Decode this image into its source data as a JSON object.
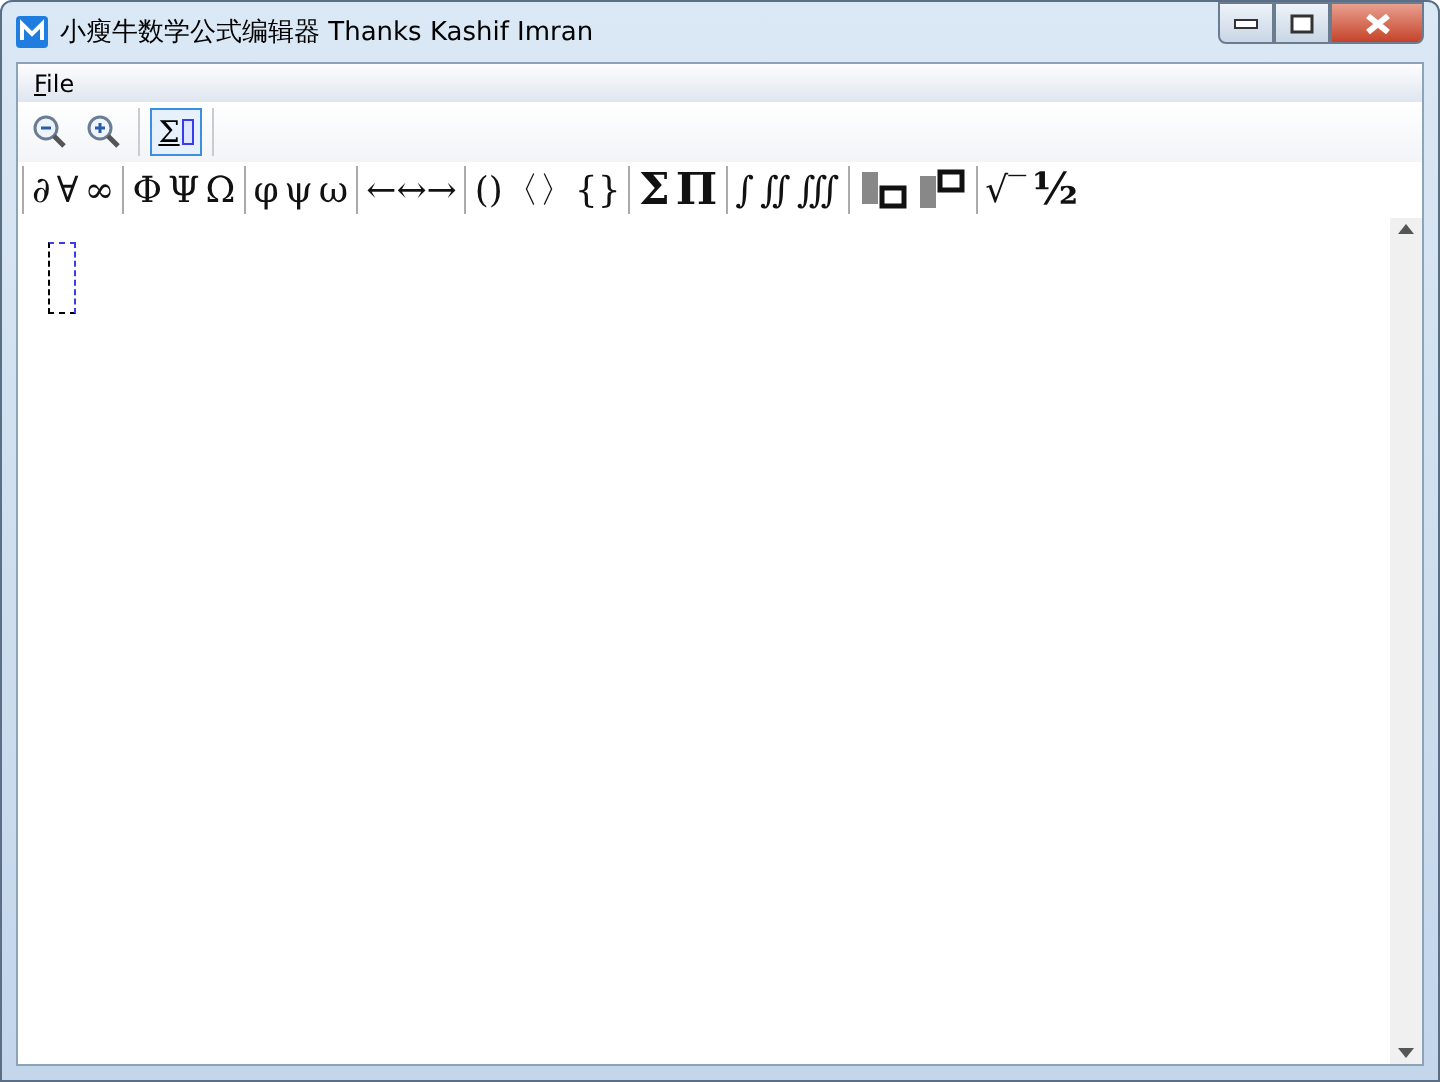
{
  "window": {
    "title": "小瘦牛数学公式编辑器 Thanks Kashif Imran"
  },
  "menu": [
    {
      "access_key": "F",
      "label_rest": "ile"
    }
  ],
  "toolbar": [
    {
      "kind": "zoom-out",
      "selected": false
    },
    {
      "kind": "zoom-in",
      "selected": false
    },
    {
      "kind": "sigma-toggle",
      "label": "Σ",
      "selected": true
    }
  ],
  "symbol_groups": [
    {
      "items": [
        {
          "kind": "text",
          "label": "∂"
        },
        {
          "kind": "text",
          "label": "∀"
        },
        {
          "kind": "text",
          "label": "∞"
        }
      ]
    },
    {
      "items": [
        {
          "kind": "text",
          "label": "Φ"
        },
        {
          "kind": "text",
          "label": "Ψ"
        },
        {
          "kind": "text",
          "label": "Ω"
        }
      ]
    },
    {
      "items": [
        {
          "kind": "text",
          "label": "φ"
        },
        {
          "kind": "text",
          "label": "ψ"
        },
        {
          "kind": "text",
          "label": "ω"
        }
      ]
    },
    {
      "items": [
        {
          "kind": "text",
          "label": "←↔→"
        }
      ]
    },
    {
      "items": [
        {
          "kind": "text",
          "label": "()〈〉{}"
        }
      ]
    },
    {
      "items": [
        {
          "kind": "big",
          "label": "Σ"
        },
        {
          "kind": "big",
          "label": "Π"
        }
      ]
    },
    {
      "items": [
        {
          "kind": "text",
          "label": "∫"
        },
        {
          "kind": "text",
          "label": "∬"
        },
        {
          "kind": "text",
          "label": "∭"
        }
      ]
    },
    {
      "items": [
        {
          "kind": "subscript"
        },
        {
          "kind": "superscript"
        }
      ]
    },
    {
      "items": [
        {
          "kind": "text",
          "label": "√‾"
        },
        {
          "kind": "big",
          "label": "½"
        }
      ]
    }
  ]
}
